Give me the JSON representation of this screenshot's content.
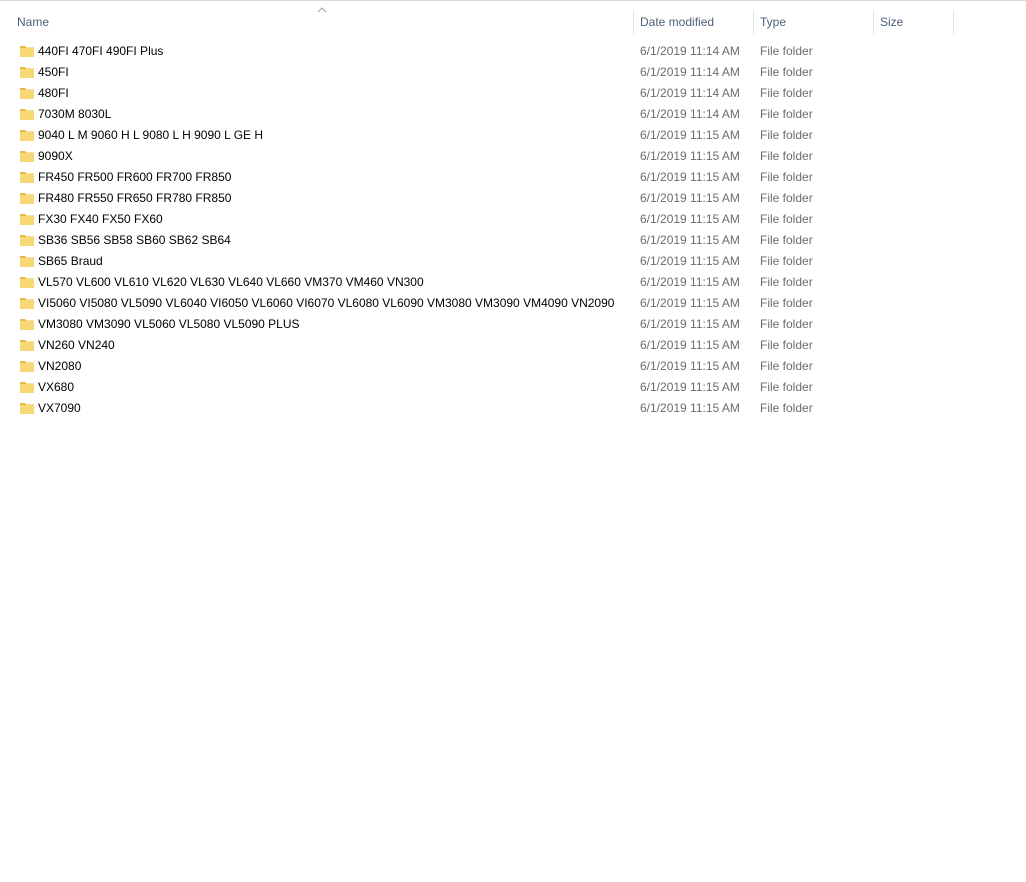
{
  "columns": {
    "name": "Name",
    "date_modified": "Date modified",
    "type": "Type",
    "size": "Size"
  },
  "sort": {
    "column": "name",
    "direction": "ascending"
  },
  "icons": {
    "folder": "folder-icon",
    "sort": "sort-ascending-icon"
  },
  "colors": {
    "folder": "#f8d775",
    "folder_dark": "#e7b94b",
    "header_text": "#4c607a",
    "meta_text": "#6d6d6d"
  },
  "files": [
    {
      "name": "440FI 470FI 490FI Plus",
      "date_modified": "6/1/2019 11:14 AM",
      "type": "File folder",
      "size": ""
    },
    {
      "name": "450FI",
      "date_modified": "6/1/2019 11:14 AM",
      "type": "File folder",
      "size": ""
    },
    {
      "name": "480FI",
      "date_modified": "6/1/2019 11:14 AM",
      "type": "File folder",
      "size": ""
    },
    {
      "name": "7030M 8030L",
      "date_modified": "6/1/2019 11:14 AM",
      "type": "File folder",
      "size": ""
    },
    {
      "name": "9040 L M  9060 H L 9080 L H 9090 L GE H",
      "date_modified": "6/1/2019 11:15 AM",
      "type": "File folder",
      "size": ""
    },
    {
      "name": "9090X",
      "date_modified": "6/1/2019 11:15 AM",
      "type": "File folder",
      "size": ""
    },
    {
      "name": "FR450 FR500 FR600 FR700 FR850",
      "date_modified": "6/1/2019 11:15 AM",
      "type": "File folder",
      "size": ""
    },
    {
      "name": "FR480 FR550 FR650 FR780 FR850",
      "date_modified": "6/1/2019 11:15 AM",
      "type": "File folder",
      "size": ""
    },
    {
      "name": "FX30 FX40 FX50 FX60",
      "date_modified": "6/1/2019 11:15 AM",
      "type": "File folder",
      "size": ""
    },
    {
      "name": "SB36 SB56 SB58 SB60 SB62 SB64",
      "date_modified": "6/1/2019 11:15 AM",
      "type": "File folder",
      "size": ""
    },
    {
      "name": "SB65 Braud",
      "date_modified": "6/1/2019 11:15 AM",
      "type": "File folder",
      "size": ""
    },
    {
      "name": "VL570 VL600 VL610 VL620 VL630 VL640 VL660 VM370 VM460 VN300",
      "date_modified": "6/1/2019 11:15 AM",
      "type": "File folder",
      "size": ""
    },
    {
      "name": "VI5060 VI5080 VL5090 VL6040 VI6050 VL6060 VI6070 VL6080 VL6090 VM3080 VM3090 VM4090 VN2090",
      "date_modified": "6/1/2019 11:15 AM",
      "type": "File folder",
      "size": ""
    },
    {
      "name": "VM3080 VM3090 VL5060 VL5080 VL5090 PLUS",
      "date_modified": "6/1/2019 11:15 AM",
      "type": "File folder",
      "size": ""
    },
    {
      "name": "VN260 VN240",
      "date_modified": "6/1/2019 11:15 AM",
      "type": "File folder",
      "size": ""
    },
    {
      "name": "VN2080",
      "date_modified": "6/1/2019 11:15 AM",
      "type": "File folder",
      "size": ""
    },
    {
      "name": "VX680",
      "date_modified": "6/1/2019 11:15 AM",
      "type": "File folder",
      "size": ""
    },
    {
      "name": "VX7090",
      "date_modified": "6/1/2019 11:15 AM",
      "type": "File folder",
      "size": ""
    }
  ]
}
